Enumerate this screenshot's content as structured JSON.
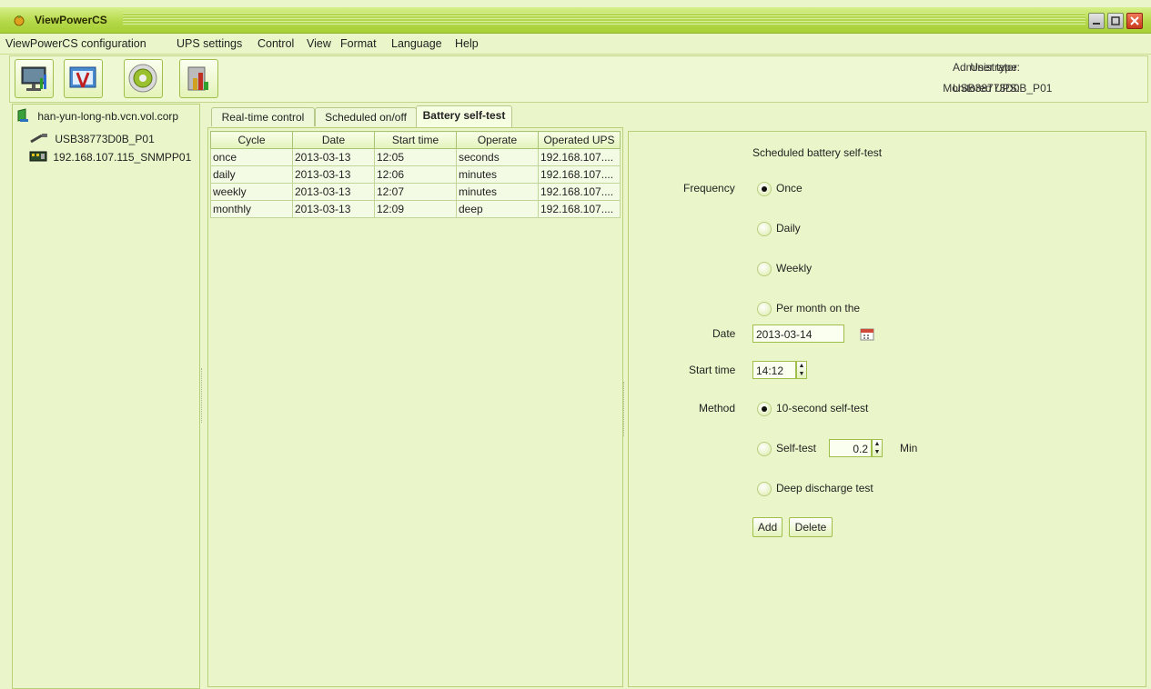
{
  "window": {
    "title": "ViewPowerCS"
  },
  "menu": [
    "ViewPowerCS configuration",
    "UPS settings",
    "Control",
    "View",
    "Format",
    "Language",
    "Help"
  ],
  "toolbar_icons": [
    "monitor-icon",
    "tools-icon",
    "gear-icon",
    "chart-icon"
  ],
  "user_info": {
    "user_type_label": "User type:",
    "user_type_value": "Administrator",
    "monitored_label": "Monitored UPS:",
    "monitored_value": "USB38773D0B_P01"
  },
  "tree": {
    "root": "han-yun-long-nb.vcn.vol.corp",
    "children": [
      "USB38773D0B_P01",
      "192.168.107.115_SNMPP01"
    ]
  },
  "tabs": [
    "Real-time control",
    "Scheduled on/off",
    "Battery self-test"
  ],
  "table": {
    "headers": [
      "Cycle",
      "Date",
      "Start time",
      "Operate",
      "Operated UPS"
    ],
    "rows": [
      [
        "once",
        "2013-03-13",
        "12:05",
        "seconds",
        "192.168.107...."
      ],
      [
        "daily",
        "2013-03-13",
        "12:06",
        "minutes",
        "192.168.107...."
      ],
      [
        "weekly",
        "2013-03-13",
        "12:07",
        "minutes",
        "192.168.107...."
      ],
      [
        "monthly",
        "2013-03-13",
        "12:09",
        "deep",
        "192.168.107...."
      ]
    ]
  },
  "form": {
    "heading": "Scheduled battery self-test",
    "frequency_label": "Frequency",
    "frequency_options": [
      "Once",
      "Daily",
      "Weekly",
      "Per month on the"
    ],
    "date_label": "Date",
    "date_value": "2013-03-14",
    "start_time_label": "Start time",
    "start_time_value": "14:12",
    "method_label": "Method",
    "method_options": [
      "10-second self-test",
      "Self-test",
      "Deep discharge test"
    ],
    "selftest_minutes": "0.2",
    "min_label": "Min",
    "add_label": "Add",
    "delete_label": "Delete"
  }
}
